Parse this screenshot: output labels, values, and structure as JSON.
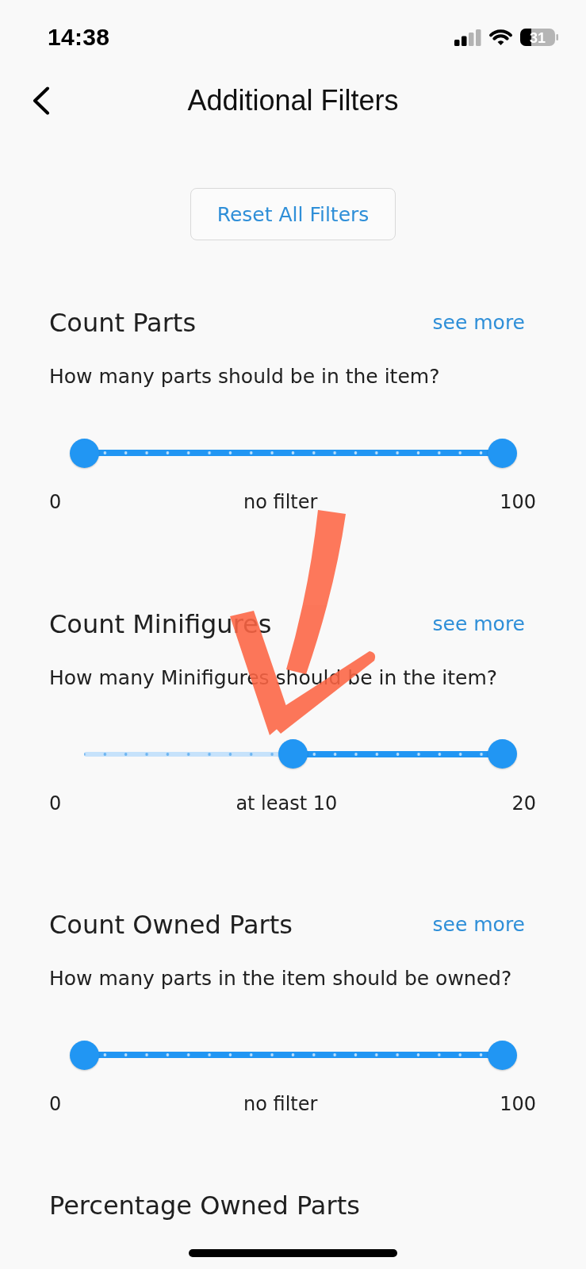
{
  "status_bar": {
    "time": "14:38",
    "battery": "31"
  },
  "header": {
    "title": "Additional Filters"
  },
  "reset_button": {
    "label": "Reset All Filters"
  },
  "filters": [
    {
      "title": "Count Parts",
      "link": "see more",
      "question": "How many parts should be in the item?",
      "slider": {
        "thumbs": [
          {
            "level": 0
          },
          {
            "level": 1
          }
        ]
      },
      "labels": {
        "min": "0",
        "value": "no filter",
        "max": "100"
      }
    },
    {
      "title": "Count Minifigures",
      "link": "see more",
      "question": "How many Minifigures should be in the item?",
      "slider": {
        "thumbs": [
          {
            "level": 0.5
          },
          {
            "level": 1
          }
        ]
      },
      "labels": {
        "min": "0",
        "value": "at least 10",
        "max": "20"
      }
    },
    {
      "title": "Count Owned Parts",
      "link": "see more",
      "question": "How many parts in the item should be owned?",
      "slider": {
        "thumbs": [
          {
            "level": 0
          },
          {
            "level": 1
          }
        ]
      },
      "labels": {
        "min": "0",
        "value": "no filter",
        "max": "100"
      }
    },
    {
      "title": "Percentage Owned Parts"
    }
  ]
}
